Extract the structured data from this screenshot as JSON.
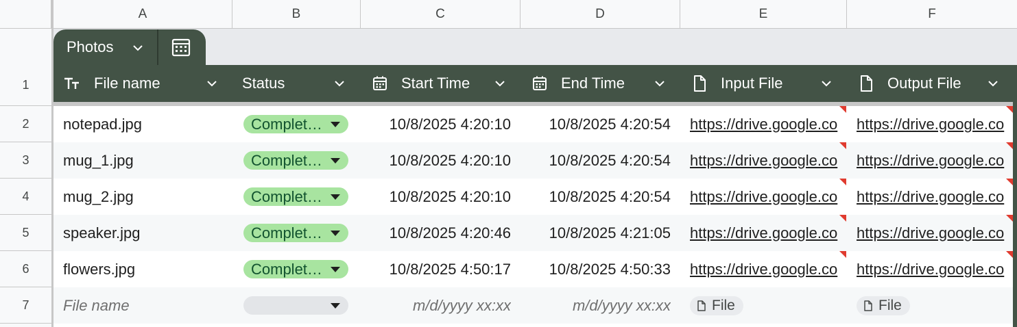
{
  "columns": [
    "A",
    "B",
    "C",
    "D",
    "E",
    "F"
  ],
  "row_numbers": [
    "1",
    "2",
    "3",
    "4",
    "5",
    "6",
    "7"
  ],
  "table": {
    "name": "Photos",
    "icons": {
      "tab_menu": "chevron-down-icon",
      "convert": "table-calculator-icon"
    }
  },
  "headers": {
    "file_name": {
      "label": "File name",
      "icon": "text-type-icon"
    },
    "status": {
      "label": "Status",
      "icon": ""
    },
    "start_time": {
      "label": "Start Time",
      "icon": "calendar-icon"
    },
    "end_time": {
      "label": "End Time",
      "icon": "calendar-icon"
    },
    "input_file": {
      "label": "Input File",
      "icon": "file-icon"
    },
    "output_file": {
      "label": "Output File",
      "icon": "file-icon"
    }
  },
  "rows": [
    {
      "file_name": "notepad.jpg",
      "status": "Complet…",
      "start": "10/8/2025 4:20:10",
      "end": "10/8/2025 4:20:54",
      "input": "https://drive.google.co",
      "output": "https://drive.google.co"
    },
    {
      "file_name": "mug_1.jpg",
      "status": "Complet…",
      "start": "10/8/2025 4:20:10",
      "end": "10/8/2025 4:20:54",
      "input": "https://drive.google.co",
      "output": "https://drive.google.co"
    },
    {
      "file_name": "mug_2.jpg",
      "status": "Complet…",
      "start": "10/8/2025 4:20:10",
      "end": "10/8/2025 4:20:54",
      "input": "https://drive.google.co",
      "output": "https://drive.google.co"
    },
    {
      "file_name": "speaker.jpg",
      "status": "Complet…",
      "start": "10/8/2025 4:20:46",
      "end": "10/8/2025 4:21:05",
      "input": "https://drive.google.co",
      "output": "https://drive.google.co"
    },
    {
      "file_name": "flowers.jpg",
      "status": "Complet…",
      "start": "10/8/2025 4:50:17",
      "end": "10/8/2025 4:50:33",
      "input": "https://drive.google.co",
      "output": "https://drive.google.co"
    }
  ],
  "new_row": {
    "file_name_placeholder": "File name",
    "start_placeholder": "m/d/yyyy xx:xx",
    "end_placeholder": "m/d/yyyy xx:xx",
    "input_chip": "File",
    "output_chip": "File"
  },
  "colors": {
    "table_header": "#435346",
    "status_complete_chip": "#a8e4a0",
    "status_complete_text": "#12532f",
    "note_flag": "#e03b2f"
  }
}
